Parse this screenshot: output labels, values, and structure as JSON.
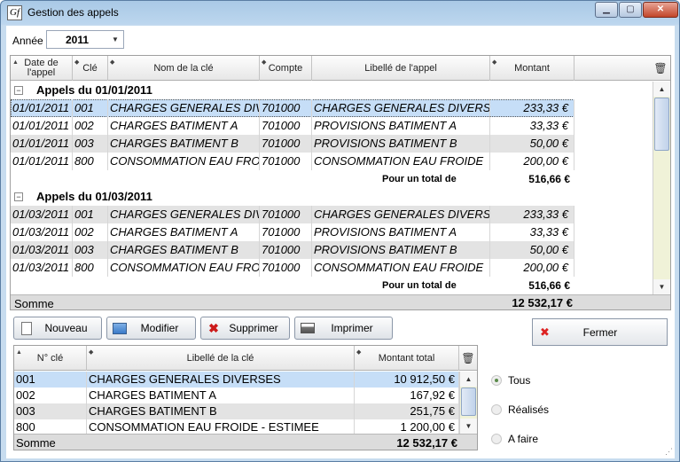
{
  "window": {
    "title": "Gestion des appels",
    "app_icon": "gestion-app-icon"
  },
  "filter": {
    "year_label": "Année",
    "year_value": "2011"
  },
  "main_grid": {
    "columns": [
      "Date de l'appel",
      "Clé",
      "Nom de la clé",
      "Compte",
      "Libellé de l'appel",
      "Montant"
    ],
    "groups": [
      {
        "title": "Appels du 01/01/2011",
        "rows": [
          {
            "date": "01/01/2011",
            "cle": "001",
            "nom": "CHARGES GENERALES DIVERSES",
            "compte": "701000",
            "libelle": "CHARGES GENERALES DIVERSES",
            "montant": "233,33 €"
          },
          {
            "date": "01/01/2011",
            "cle": "002",
            "nom": "CHARGES BATIMENT A",
            "compte": "701000",
            "libelle": "PROVISIONS BATIMENT A",
            "montant": "33,33 €"
          },
          {
            "date": "01/01/2011",
            "cle": "003",
            "nom": "CHARGES BATIMENT B",
            "compte": "701000",
            "libelle": "PROVISIONS BATIMENT B",
            "montant": "50,00 €"
          },
          {
            "date": "01/01/2011",
            "cle": "800",
            "nom": "CONSOMMATION EAU FROIDE - ESTIMEE",
            "compte": "701000",
            "libelle": "CONSOMMATION EAU FROIDE",
            "montant": "200,00 €"
          }
        ],
        "total_label": "Pour un total de",
        "total_value": "516,66 €"
      },
      {
        "title": "Appels du 01/03/2011",
        "rows": [
          {
            "date": "01/03/2011",
            "cle": "001",
            "nom": "CHARGES GENERALES DIVERSES",
            "compte": "701000",
            "libelle": "CHARGES GENERALES DIVERSES",
            "montant": "233,33 €"
          },
          {
            "date": "01/03/2011",
            "cle": "002",
            "nom": "CHARGES BATIMENT A",
            "compte": "701000",
            "libelle": "PROVISIONS BATIMENT A",
            "montant": "33,33 €"
          },
          {
            "date": "01/03/2011",
            "cle": "003",
            "nom": "CHARGES BATIMENT B",
            "compte": "701000",
            "libelle": "PROVISIONS BATIMENT B",
            "montant": "50,00 €"
          },
          {
            "date": "01/03/2011",
            "cle": "800",
            "nom": "CONSOMMATION EAU FROIDE - ESTIMEE",
            "compte": "701000",
            "libelle": "CONSOMMATION EAU FROIDE",
            "montant": "200,00 €"
          }
        ],
        "total_label": "Pour un total de",
        "total_value": "516,66 €"
      }
    ],
    "footer_label": "Somme",
    "footer_value": "12 532,17 €"
  },
  "toolbar": {
    "new_label": "Nouveau",
    "edit_label": "Modifier",
    "delete_label": "Supprimer",
    "print_label": "Imprimer",
    "close_label": "Fermer"
  },
  "keys_grid": {
    "columns": [
      "N° clé",
      "Libellé de la clé",
      "Montant total"
    ],
    "rows": [
      {
        "num": "001",
        "libelle": "CHARGES GENERALES DIVERSES",
        "montant": "10 912,50 €"
      },
      {
        "num": "002",
        "libelle": "CHARGES BATIMENT A",
        "montant": "167,92 €"
      },
      {
        "num": "003",
        "libelle": "CHARGES BATIMENT B",
        "montant": "251,75 €"
      },
      {
        "num": "800",
        "libelle": "CONSOMMATION EAU FROIDE - ESTIMEE",
        "montant": "1 200,00 €"
      }
    ],
    "footer_label": "Somme",
    "footer_value": "12 532,17 €"
  },
  "filter_options": {
    "selected": "Tous",
    "options": [
      "Tous",
      "Réalisés",
      "A faire"
    ]
  },
  "colors": {
    "selected_row": "#c6def7",
    "alt_row": "#e3e3e3",
    "footer": "#dcdcdc",
    "scroll_track": "#f0f2d8"
  }
}
